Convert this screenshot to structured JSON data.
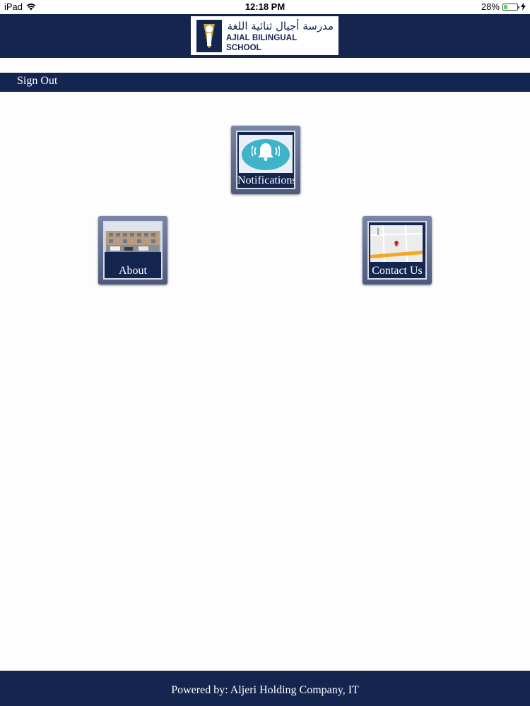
{
  "status_bar": {
    "device": "iPad",
    "time": "12:18 PM",
    "battery": "28%",
    "battery_level": 0.28
  },
  "header": {
    "logo_text_arabic": "مدرسة أجيال ثنائية اللغة",
    "logo_text_english": "AJIAL BILINGUAL SCHOOL"
  },
  "nav": {
    "sign_out": "Sign Out"
  },
  "tiles": [
    {
      "label": "Notifications",
      "icon": "bell-icon"
    },
    {
      "label": "About",
      "icon": "school-photo"
    },
    {
      "label": "Contact Us",
      "icon": "map-icon"
    }
  ],
  "footer": {
    "text": "Powered by: Aljeri Holding Company, IT"
  },
  "colors": {
    "brand_navy": "#14254f",
    "accent_teal": "#3fb3c8",
    "background": "#fdfdfd"
  }
}
